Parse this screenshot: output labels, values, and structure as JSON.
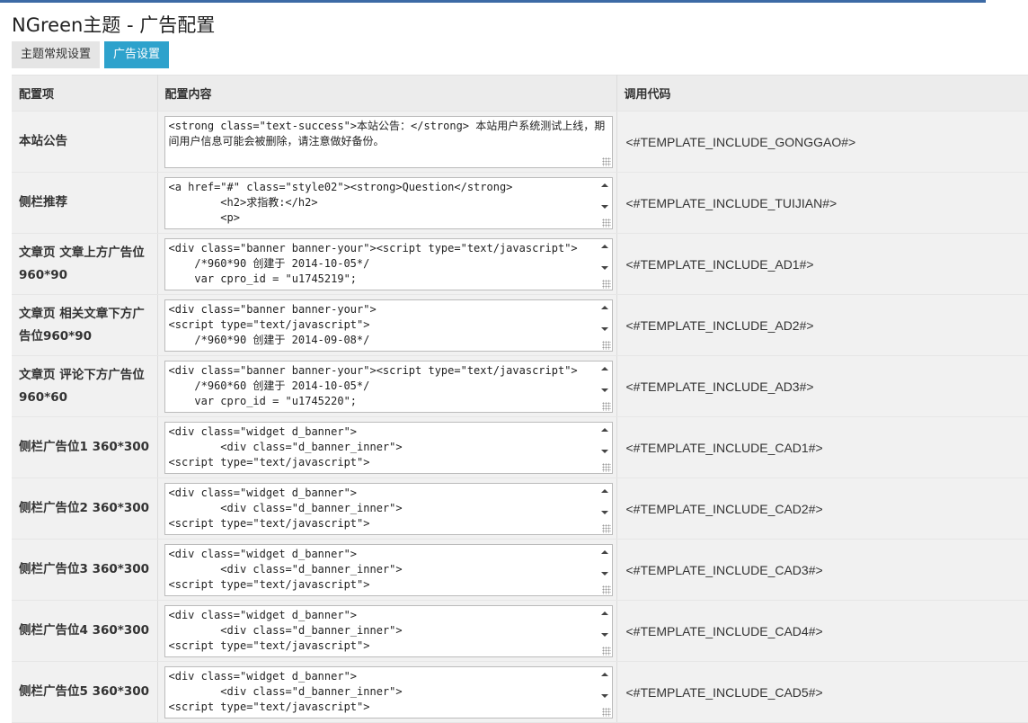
{
  "page": {
    "title": "NGreen主题 - 广告配置"
  },
  "tabs": [
    {
      "label": "主题常规设置",
      "active": false
    },
    {
      "label": "广告设置",
      "active": true
    }
  ],
  "table": {
    "headers": {
      "item": "配置项",
      "content": "配置内容",
      "code": "调用代码"
    },
    "rows": [
      {
        "item": "本站公告",
        "content": "<strong class=\"text-success\">本站公告：</strong>        本站用户系统测试上线，期间用户信息可能会被删除，请注意做好备份。",
        "code": "<#TEMPLATE_INCLUDE_GONGGAO#>"
      },
      {
        "item": "侧栏推荐",
        "content": "<a href=\"#\" class=\"style02\"><strong>Question</strong>\n        <h2>求指教:</h2>\n        <p>",
        "code": "<#TEMPLATE_INCLUDE_TUIJIAN#>"
      },
      {
        "item": "文章页 文章上方广告位960*90",
        "content": "<div class=\"banner banner-your\"><script type=\"text/javascript\">\n    /*960*90 创建于 2014-10-05*/\n    var cpro_id = \"u1745219\";",
        "code": "<#TEMPLATE_INCLUDE_AD1#>"
      },
      {
        "item": "文章页 相关文章下方广告位960*90",
        "content": "<div class=\"banner banner-your\">\n<script type=\"text/javascript\">\n    /*960*90 创建于 2014-09-08*/",
        "code": "<#TEMPLATE_INCLUDE_AD2#>"
      },
      {
        "item": "文章页 评论下方广告位960*60",
        "content": "<div class=\"banner banner-your\"><script type=\"text/javascript\">\n    /*960*60 创建于 2014-10-05*/\n    var cpro_id = \"u1745220\";",
        "code": "<#TEMPLATE_INCLUDE_AD3#>"
      },
      {
        "item": "侧栏广告位1 360*300",
        "content": "<div class=\"widget d_banner\">\n        <div class=\"d_banner_inner\">\n<script type=\"text/javascript\">",
        "code": "<#TEMPLATE_INCLUDE_CAD1#>"
      },
      {
        "item": "侧栏广告位2 360*300",
        "content": "<div class=\"widget d_banner\">\n        <div class=\"d_banner_inner\">\n<script type=\"text/javascript\">",
        "code": "<#TEMPLATE_INCLUDE_CAD2#>"
      },
      {
        "item": "侧栏广告位3 360*300",
        "content": "<div class=\"widget d_banner\">\n        <div class=\"d_banner_inner\">\n<script type=\"text/javascript\">",
        "code": "<#TEMPLATE_INCLUDE_CAD3#>"
      },
      {
        "item": "侧栏广告位4 360*300",
        "content": "<div class=\"widget d_banner\">\n        <div class=\"d_banner_inner\">\n<script type=\"text/javascript\">",
        "code": "<#TEMPLATE_INCLUDE_CAD4#>"
      },
      {
        "item": "侧栏广告位5 360*300",
        "content": "<div class=\"widget d_banner\">\n        <div class=\"d_banner_inner\">\n<script type=\"text/javascript\">",
        "code": "<#TEMPLATE_INCLUDE_CAD5#>"
      }
    ]
  }
}
